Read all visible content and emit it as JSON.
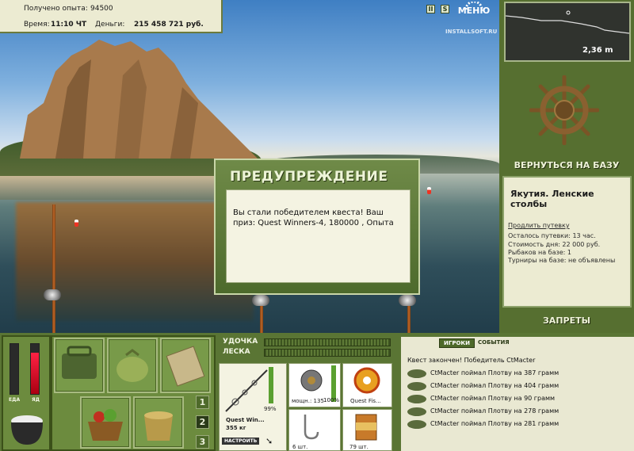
{
  "stats": {
    "xp_label": "Получено опыта:",
    "xp_value": "94500",
    "time_label": "Время:",
    "time_value": "11:10 ЧТ",
    "money_label": "Деньги:",
    "money_value": "215 458 721 руб."
  },
  "toolbar": {
    "pause_label": "II",
    "sound_label": "S",
    "menu_label": "МЕНЮ"
  },
  "watermark": {
    "line1": "INSTALLSOFT.RU"
  },
  "depth": {
    "value": "2,36 m"
  },
  "right": {
    "return_label": "ВЕРНУТЬСЯ НА БАЗУ",
    "location_title": "Якутия. Ленские столбы",
    "extend_link": "Продлить путевку",
    "trip_left": "Осталось путевки: 13 час.",
    "day_cost": "Стоимость дня: 22 000 руб.",
    "fishers": "Рыбаков на базе: 1",
    "tournaments": "Турниры на базе: не объявлены",
    "bans_label": "ЗАПРЕТЫ"
  },
  "dialog": {
    "title": "ПРЕДУПРЕЖДЕНИЕ",
    "message": "Вы стали победителем квеста! Ваш приз: Quest Winners-4, 180000 , Опыта"
  },
  "needs": {
    "food_label": "ЕДА",
    "poison_label": "ЯД",
    "food_level": 0.0,
    "poison_level": 0.82
  },
  "slots": {
    "numbers": [
      "1",
      "2",
      "3"
    ]
  },
  "tackle": {
    "rod_label": "УДОЧКА",
    "line_label": "ЛЕСКА",
    "rod_name": "Quest Win...",
    "rod_weight": "355 кг",
    "rod_percent": "99%",
    "setup_button": "НАСТРОИТЬ",
    "reel_power": "мощн.: 135",
    "reel_percent": "100%",
    "line_name": "Quest Fis...",
    "hook_count": "6 шт.",
    "bait_count": "79 шт."
  },
  "log": {
    "tab_players": "ИГРОКИ",
    "tab_events": "СОБЫТИЯ",
    "entries": [
      "Квест закончен! Победитель CtMacter",
      "CtMacter поймал Плотву на 387 грамм",
      "CtMacter поймал Плотву на 404 грамм",
      "CtMacter поймал Плотву на 90 грамм",
      "CtMacter поймал Плотву на 278 грамм",
      "CtMacter поймал Плотву на 281 грамм"
    ]
  }
}
